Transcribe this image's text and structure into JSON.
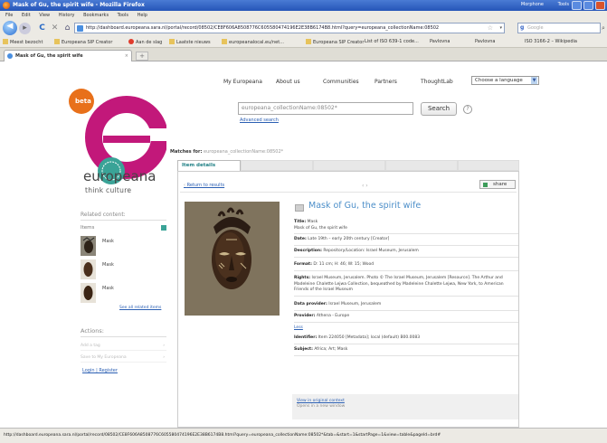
{
  "window": {
    "title": "Mask of Gu, the spirit wife - Mozilla Firefox",
    "tray_left": "Morphone",
    "tray_right": "Tools"
  },
  "menubar": [
    "File",
    "Edit",
    "View",
    "History",
    "Bookmarks",
    "Tools",
    "Help"
  ],
  "navigation": {
    "url": "http://dashboard.europeana.sara.nl/portal/record/08502/CE8F606A8508776C605580474196E2E38B6174B8.html?query=europeana_collectionName:08502",
    "search_engine": "Google"
  },
  "bookmarks": [
    "Meest bezocht",
    "Europeana SIP Creator",
    "Aan de slag",
    "Laatste nieuws",
    "europeanalocal.eu/net...",
    "Europeana SIP Creator",
    "List of ISO 639-1 code...",
    "Pavlovna",
    "Pavlovna",
    "ISO 3166-2 – Wikipedia"
  ],
  "tab": {
    "title": "Mask of Gu, the spirit wife"
  },
  "site": {
    "topnav": [
      "My Europeana",
      "About us",
      "Communities",
      "Partners",
      "ThoughtLab"
    ],
    "language_select": "Choose a language",
    "beta_badge": "beta",
    "logo_text": "europeana",
    "logo_sub": "think culture",
    "search_value": "europeana_collectionName:08502*",
    "search_button": "Search",
    "advanced_search": "Advanced search",
    "matches_label": "Matches for:",
    "matches_query": "europeana_collectionName:08502*"
  },
  "item": {
    "tab_label": "Item details",
    "return_link": "Return to results",
    "pager": "‹ ›",
    "share": "share",
    "title": "Mask of Gu, the spirit wife",
    "fields": [
      {
        "label": "Title:",
        "value": "Mask\nMask of Gu, the spirit wife"
      },
      {
        "label": "Date:",
        "value": "Late 19th – early 20th century [Creator]"
      },
      {
        "label": "Description:",
        "value": "Repository/Location: Israel Museum, Jerusalem"
      },
      {
        "label": "Format:",
        "value": "D: 11 cm; H: 46; W: 15; Wood"
      },
      {
        "label": "Rights:",
        "value": "Israel Museum, Jerusalem. Photo © The Israel Museum, Jerusalem [Resource]. The Arthur and Madeleine Chalette Lejwa Collection, bequeathed by Madeleine Chalette Lejwa, New York, to American Friends of the Israel Museum"
      },
      {
        "label": "Data provider:",
        "value": "Israel Museum, Jerusalem"
      },
      {
        "label": "Provider:",
        "value": "Athena - Europe"
      },
      {
        "label": "",
        "value": "Less",
        "link": true
      },
      {
        "label": "Identifier:",
        "value": "Item 224050 [Metadata]; local (default) B00.0083"
      },
      {
        "label": "Subject:",
        "value": "Africa; Art; Mask"
      }
    ],
    "view_original": "View in original context",
    "opens_new_window": "Opens in a new window"
  },
  "sidebar": {
    "related_heading": "Related content:",
    "items_heading": "Items",
    "related_items": [
      "Mask",
      "Mask",
      "Mask"
    ],
    "see_all": "See all related items",
    "actions_heading": "Actions:",
    "actions": [
      "Add a tag",
      "Save to My Europeana"
    ],
    "login": "Login | Register"
  },
  "statusbar": {
    "text": "http://dashboard.europeana.sara.nl/portal/record/08502/CE8F606A8508776C605580474196E2E38B6174B8.html?query=europeana_collectionName:08502*&tab=&start=1&startPage=1&view=table&pageId=brd#"
  },
  "colors": {
    "brand_magenta": "#c2187a",
    "brand_teal": "#3aa397",
    "link_blue": "#2b5fb3",
    "title_blue": "#4d8fc9",
    "beta_orange": "#e8701a"
  }
}
